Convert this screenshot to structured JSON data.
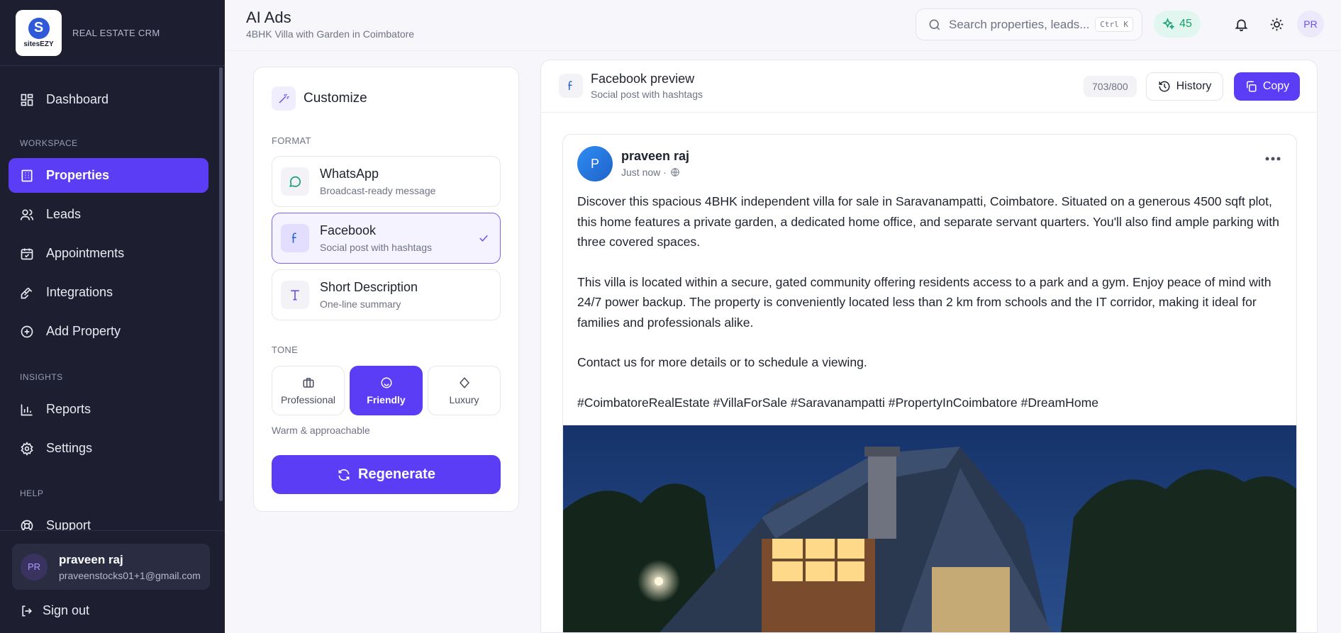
{
  "brand": {
    "logo_text": "sitesEZY",
    "logo_letter": "S",
    "subtitle": "REAL ESTATE CRM"
  },
  "sidebar": {
    "dashboard": "Dashboard",
    "sections": {
      "workspace": "WORKSPACE",
      "insights": "INSIGHTS",
      "help": "HELP"
    },
    "items": [
      {
        "label": "Properties",
        "icon": "building-icon",
        "active": true
      },
      {
        "label": "Leads",
        "icon": "users-icon"
      },
      {
        "label": "Appointments",
        "icon": "calendar-icon"
      },
      {
        "label": "Integrations",
        "icon": "plug-icon"
      },
      {
        "label": "Add Property",
        "icon": "plus-circle-icon"
      },
      {
        "label": "Reports",
        "icon": "bar-chart-icon"
      },
      {
        "label": "Settings",
        "icon": "gear-icon"
      },
      {
        "label": "Support",
        "icon": "lifebuoy-icon"
      }
    ],
    "user": {
      "initials": "PR",
      "name": "praveen raj",
      "email": "praveenstocks01+1@gmail.com"
    },
    "signout": "Sign out"
  },
  "header": {
    "title": "AI Ads",
    "subtitle": "4BHK Villa with Garden in Coimbatore",
    "search_placeholder": "Search properties, leads...",
    "shortcut": "Ctrl K",
    "credits": "45",
    "avatar_initials": "PR"
  },
  "customize": {
    "title": "Customize",
    "format_label": "FORMAT",
    "formats": [
      {
        "title": "WhatsApp",
        "sub": "Broadcast-ready message"
      },
      {
        "title": "Facebook",
        "sub": "Social post with hashtags",
        "selected": true
      },
      {
        "title": "Short Description",
        "sub": "One-line summary"
      }
    ],
    "tone_label": "TONE",
    "tones": [
      {
        "label": "Professional"
      },
      {
        "label": "Friendly",
        "selected": true
      },
      {
        "label": "Luxury"
      }
    ],
    "tone_desc": "Warm & approachable",
    "regenerate": "Regenerate"
  },
  "preview": {
    "title": "Facebook preview",
    "subtitle": "Social post with hashtags",
    "counter": "703/800",
    "history": "History",
    "copy": "Copy",
    "post": {
      "avatar_letter": "P",
      "author": "praveen raj",
      "time": "Just now ·",
      "paragraphs": [
        "Discover this spacious 4BHK independent villa for sale in Saravanampatti, Coimbatore. Situated on a generous 4500 sqft plot, this home features a private garden, a dedicated home office, and separate servant quarters. You'll also find ample parking with three covered spaces.",
        "This villa is located within a secure, gated community offering residents access to a park and a gym. Enjoy peace of mind with 24/7 power backup. The property is conveniently located less than 2 km from schools and the IT corridor, making it ideal for families and professionals alike.",
        "Contact us for more details or to schedule a viewing.",
        "#CoimbatoreRealEstate #VillaForSale #Saravanampatti #PropertyInCoimbatore #DreamHome"
      ]
    }
  }
}
